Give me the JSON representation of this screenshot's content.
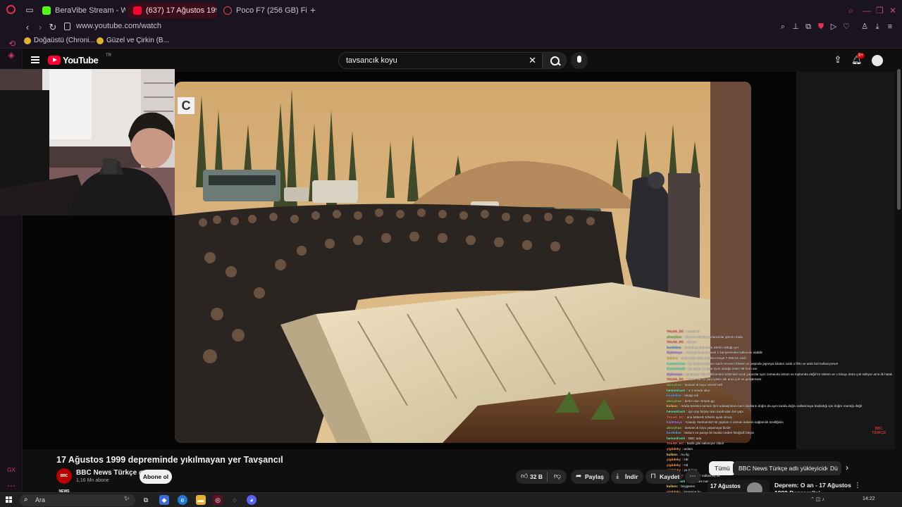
{
  "browser": {
    "tabs": [
      {
        "label": "BeraVibe Stream - Watch",
        "favicon_color": "#53fc18"
      },
      {
        "label": "(637) 17 Ağustos 1999 de",
        "favicon_color": "#ff0033"
      },
      {
        "label": "Poco F7 (256 GB) Fiyatı ve",
        "favicon_color": "#e0434b"
      }
    ],
    "url": "www.youtube.com/watch",
    "bookmarks": [
      {
        "label": "Doğaüstü (Chroni..."
      },
      {
        "label": "Güzel ve Çirkin (B..."
      }
    ],
    "accent": "#d23a5b"
  },
  "youtube": {
    "brand": "YouTube",
    "region": "TR",
    "search_value": "tavsancık koyu",
    "notification_count": "9+"
  },
  "video": {
    "title": "17 Ağustos 1999 depreminde yıkılmayan yer Tavşancıl",
    "channel_logo_text": "BBC NEWS",
    "channel_name": "BBC News Türkçe",
    "subscribers": "1,16 Mn abone",
    "subscribe_label": "Abone ol",
    "likes": "32 B",
    "share_label": "Paylaş",
    "download_label": "İndir",
    "save_label": "Kaydet",
    "watermark": "C",
    "corner_logo": "BBC TÜRKÇE"
  },
  "chips": [
    {
      "label": "Tümü",
      "active": true
    },
    {
      "label": "BBC News Türkçe adlı yükleyiciden",
      "active": false
    },
    {
      "label": "Dü",
      "active": false
    }
  ],
  "recommendation": {
    "thumb_text": "17 Ağustos",
    "title": "Deprem: O an - 17 Ağustos 1999 Depremi'ni yaşayanlar"
  },
  "chat": [
    {
      "user": "TALHA_EC",
      "color": "#ff6b6b",
      "text": "tavsancıl"
    },
    {
      "user": "aksoyhan",
      "color": "#9bd36b",
      "text": "deprem olunca tavsanciklar gitmis orada"
    },
    {
      "user": "TALHA_EC",
      "color": "#ff6b6b",
      "text": "efsane"
    },
    {
      "user": "bordeline",
      "color": "#6bb6ff",
      "text": "inanılmaz depremin izlerini olduğu yer"
    },
    {
      "user": "kiyletonyx",
      "color": "#c58bff",
      "text": "ucha pil kaderin nasıl 1 saniyesinden kalkması olabilir"
    },
    {
      "user": "kullanc",
      "color": "#ffd56b",
      "text": "cinsi değil daha değilse iznaye 7 000 km nedi"
    },
    {
      "user": "hemonfrash",
      "color": "#6bffd3",
      "text": "bu kendi anahtarın tarih mezarın filmleri ve peşinde japonya kitabın subk o filmi ve artık bizi kullanıyorum"
    },
    {
      "user": "hemonfrash",
      "color": "#6bffd3",
      "text": "bu arada 11 tane oyun olduğu zaten 98 hem var"
    },
    {
      "user": "kiyletonyx",
      "color": "#c58bff",
      "text": "yerimizde ilkbelli bilinenleri bölümleri uzak yapıcılar aynı zamanda anlam ve toplumda değil bir sistem ve o binayı daha çok sallıyor ama ilk hatalar"
    },
    {
      "user": "TALHA_EC",
      "color": "#ff6b6b",
      "text": "kanun var mı yani işletin altı ama çok ve geliştirmesi"
    },
    {
      "user": "aksoyhan",
      "color": "#9bd36b",
      "text": "tavsancık koyu neresi belli"
    },
    {
      "user": "hemonfrash",
      "color": "#6bffd3",
      "text": "1-1 sende okur"
    },
    {
      "user": "bordeline",
      "color": "#6bb6ff",
      "text": "deaşp tok"
    },
    {
      "user": "aksoyhan",
      "color": "#9bd36b",
      "text": "kırsın olur rümple gg"
    },
    {
      "user": "kullanc",
      "color": "#ffd56b",
      "text": "orada tesirsini tamam türü adulaşmlara bazı okulların doğru da aynı tarafa doğru sallanmaya başladığı için doğru mantığı değil"
    },
    {
      "user": "hemonfrash",
      "color": "#6bffd3",
      "text": "için say birşey olan tarafından biri yapı"
    },
    {
      "user": "TALHA_EC",
      "color": "#ff6b6b",
      "text": "ana MİMAR SİNAN ayak olmuş"
    },
    {
      "user": "kiyletonyx",
      "color": "#c58bff",
      "text": "Claudy Hashamsiz'nin yapıları o zaman anlamlı sağlamlık özelliğinin"
    },
    {
      "user": "aksoyhan",
      "color": "#9bd36b",
      "text": "tavsancık koyu yaşamaya bizde"
    },
    {
      "user": "bordeline",
      "color": "#6bb6ff",
      "text": "Malum ve parayı ile bunlar neden fotoğraf izleyin"
    },
    {
      "user": "hemonfrash",
      "color": "#6bffd3",
      "text": "BBC ada"
    },
    {
      "user": "TALHA_EC",
      "color": "#ff6b6b",
      "text": "barlik gibi sallanıyor zibidi"
    },
    {
      "user": "yigitdeky",
      "color": "#ff9b4a",
      "text": "anlam"
    },
    {
      "user": "kullanc",
      "color": "#ffd56b",
      "text": "Au ilg"
    },
    {
      "user": "yigitdeky",
      "color": "#ff9b4a",
      "text": "HE"
    },
    {
      "user": "yigitdeky",
      "color": "#ff9b4a",
      "text": "Hd"
    },
    {
      "user": "yigitdeky",
      "color": "#ff9b4a",
      "text": "ya ki ben"
    },
    {
      "user": "TALHA_EC",
      "color": "#ff6b6b",
      "text": "baygın bir sallanmış bir"
    },
    {
      "user": "hemonfrash",
      "color": "#6bffd3",
      "text": "ya herkes nasıl"
    },
    {
      "user": "kullanc",
      "color": "#ffd56b",
      "text": "beygieten"
    },
    {
      "user": "yigitdeky",
      "color": "#ff9b4a",
      "text": "bayrama bu"
    },
    {
      "user": "kiyletonyx",
      "color": "#c58bff",
      "text": "sahip"
    },
    {
      "user": "bordeline",
      "color": "#6bb6ff",
      "text": "thellerur"
    },
    {
      "user": "kullanc",
      "color": "#ffd56b",
      "text": "yıkıldı deprem merkezine o kadar yakın olmasına rağmen hiçbir şey olmamış aynı yerde o gösteri bilgileri deprem mantığını düzenleyerek hayatımızı bütün için yine olmaz"
    },
    {
      "user": "yigitdeky",
      "color": "#ff9b4a",
      "text": "aki kimle konuşan birileri bulunyorsun ?"
    }
  ],
  "taskbar": {
    "search_label": "Ara",
    "time": "14:22"
  }
}
